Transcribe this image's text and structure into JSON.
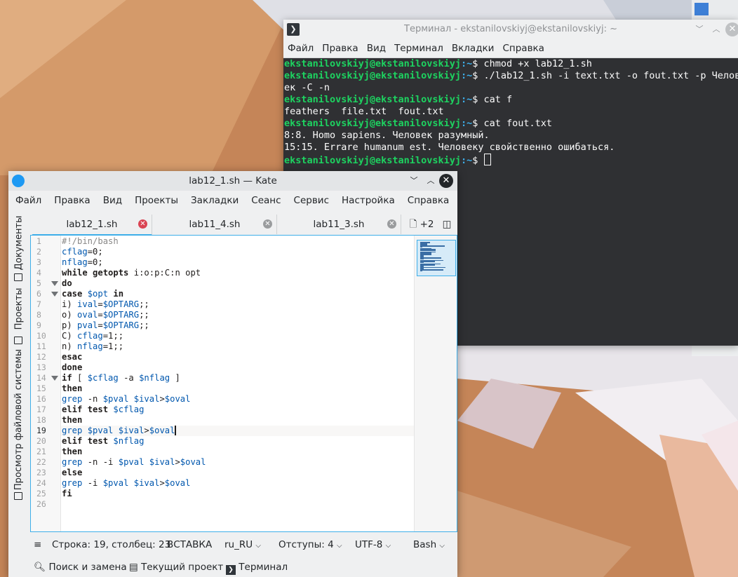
{
  "terminal": {
    "title": "Терминал - ekstanilovskiyj@ekstanilovskiyj: ~",
    "menu": [
      "Файл",
      "Правка",
      "Вид",
      "Терминал",
      "Вкладки",
      "Справка"
    ],
    "prompt_user": "ekstanilovskiyj@ekstanilovskiyj",
    "prompt_path": ":~",
    "prompt_sym": "$ ",
    "lines": [
      {
        "type": "prompt",
        "cmd": "chmod +x lab12_1.sh"
      },
      {
        "type": "prompt",
        "cmd": "./lab12_1.sh -i text.txt -o fout.txt -p Челов"
      },
      {
        "type": "out",
        "text": "ек -C -n"
      },
      {
        "type": "prompt",
        "cmd": "cat f"
      },
      {
        "type": "out",
        "text": "feathers  file.txt  fout.txt"
      },
      {
        "type": "prompt",
        "cmd": "cat fout.txt"
      },
      {
        "type": "out",
        "text": "8:8. Homo sapiens. Человек разумный."
      },
      {
        "type": "out",
        "text": "15:15. Errare humanum est. Человеку свойственно ошибаться."
      },
      {
        "type": "prompt",
        "cmd": ""
      }
    ]
  },
  "kate": {
    "title": "lab12_1.sh — Kate",
    "menu": [
      "Файл",
      "Правка",
      "Вид",
      "Проекты",
      "Закладки",
      "Сеанс",
      "Сервис",
      "Настройка",
      "Справка"
    ],
    "side_tabs": {
      "documents": "Документы",
      "projects": "Проекты",
      "filesystem": "Просмотр файловой системы"
    },
    "tabs": [
      {
        "label": "lab12_1.sh",
        "active": true
      },
      {
        "label": "lab11_4.sh",
        "active": false
      },
      {
        "label": "lab11_3.sh",
        "active": false
      }
    ],
    "more_tabs": "+2",
    "current_line": 19,
    "code": [
      "#!/bin/bash",
      "cflag=0;",
      "nflag=0;",
      "while getopts i:o:p:C:n opt",
      "do",
      "case $opt in",
      "i) ival=$OPTARG;;",
      "o) oval=$OPTARG;;",
      "p) pval=$OPTARG;;",
      "C) cflag=1;;",
      "n) nflag=1;;",
      "esac",
      "done",
      "if [ $cflag -a $nflag ]",
      "then",
      "grep -n $pval $ival>$oval",
      "elif test $cflag",
      "then",
      "grep $pval $ival>$oval",
      "elif test $nflag",
      "then",
      "grep -n -i $pval $ival>$oval",
      "else",
      "grep -i $pval $ival>$oval",
      "fi",
      ""
    ],
    "fold_lines": [
      5,
      6,
      14
    ],
    "status": {
      "position": "Строка: 19, столбец: 23",
      "mode": "ВСТАВКА",
      "language": "ru_RU",
      "indent": "Отступы: 4",
      "encoding": "UTF-8",
      "syntax": "Bash"
    },
    "bottom": {
      "search": "Поиск и замена",
      "project": "Текущий проект",
      "terminal": "Терминал"
    }
  }
}
